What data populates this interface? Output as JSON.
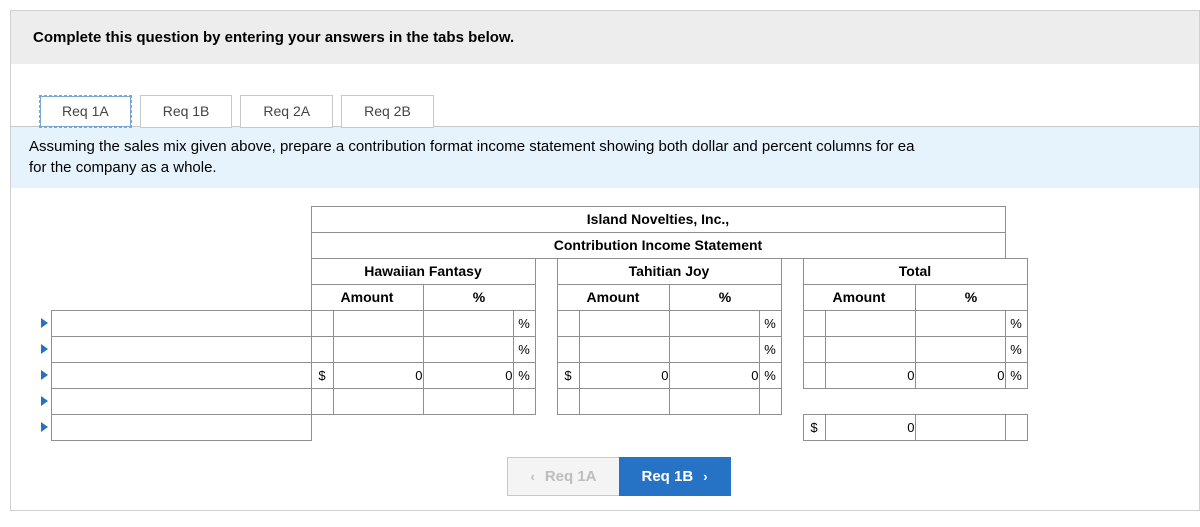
{
  "instruction": "Complete this question by entering your answers in the tabs below.",
  "tabs": {
    "t1": "Req 1A",
    "t2": "Req 1B",
    "t3": "Req 2A",
    "t4": "Req 2B"
  },
  "question_text": "Assuming the sales mix given above, prepare a contribution format income statement showing both dollar and percent columns for ea for the company as a whole.",
  "question_line1": "Assuming the sales mix given above, prepare a contribution format income statement showing both dollar and percent columns for ea",
  "question_line2": "for the company as a whole.",
  "sheet": {
    "title1": "Island Novelties, Inc.,",
    "title2": "Contribution Income Statement",
    "group1": "Hawaiian Fantasy",
    "group2": "Tahitian Joy",
    "group3": "Total",
    "amount_label": "Amount",
    "pct_label": "%",
    "dollar_sym": "$",
    "pct_sym": "%",
    "zero": "0",
    "zero_pct": "0"
  },
  "nav": {
    "prev": "Req 1A",
    "next": "Req 1B"
  }
}
